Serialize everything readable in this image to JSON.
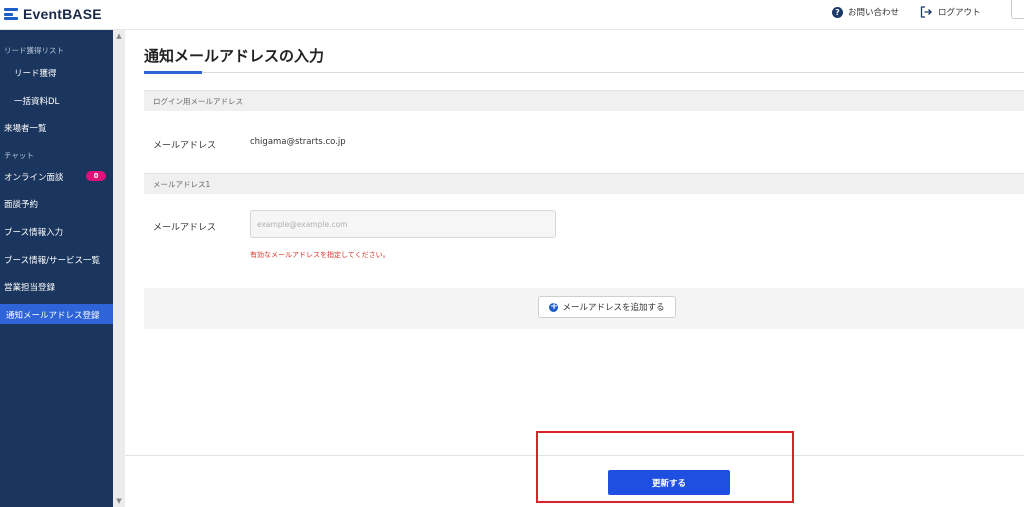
{
  "header": {
    "logo_text": "EventBASE",
    "help_icon": "question-circle-icon",
    "help_label": "お問い合わせ",
    "logout_icon": "logout-icon",
    "logout_label": "ログアウト"
  },
  "sidebar": {
    "items": [
      {
        "label": "リード獲得リスト",
        "kind": "section"
      },
      {
        "label": "リード獲得",
        "kind": "sub"
      },
      {
        "label": "一括資料DL",
        "kind": "sub"
      },
      {
        "label": "来場者一覧",
        "kind": "item"
      },
      {
        "label": "チャット",
        "kind": "section"
      },
      {
        "label": "オンライン面談",
        "kind": "item",
        "badge": "0"
      },
      {
        "label": "面談予約",
        "kind": "item"
      },
      {
        "label": "ブース情報入力",
        "kind": "item"
      },
      {
        "label": "ブース情報/サービス一覧",
        "kind": "item"
      },
      {
        "label": "営業担当登録",
        "kind": "item"
      },
      {
        "label": "通知メールアドレス登録",
        "kind": "item",
        "active": true
      }
    ],
    "accent_color": "#2e64d8",
    "badge_color": "#e0127a"
  },
  "main": {
    "title": "通知メールアドレスの入力",
    "login_section": {
      "heading": "ログイン用メールアドレス",
      "label": "メールアドレス",
      "value": "chigama@strarts.co.jp"
    },
    "email1_section": {
      "heading": "メールアドレス1",
      "label": "メールアドレス",
      "input_value": "",
      "placeholder": "example@example.com",
      "error": "有効なメールアドレスを指定してください。"
    },
    "add_button": {
      "icon": "plus-circle-icon",
      "label": "メールアドレスを追加する"
    },
    "submit_button": "更新する",
    "submit_color": "#1e4fe0",
    "highlight_color": "#d8232a"
  }
}
